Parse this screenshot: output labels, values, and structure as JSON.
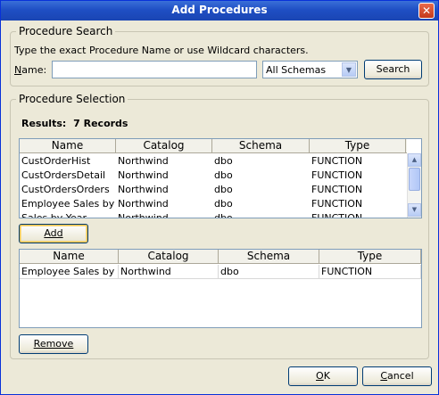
{
  "window": {
    "title": "Add Procedures",
    "close_glyph": "✕"
  },
  "search": {
    "legend": "Procedure Search",
    "instruction": "Type the exact Procedure Name or use Wildcard characters.",
    "name_label_ul": "N",
    "name_label_rest": "ame:",
    "name_value": "",
    "schema_selected": "All Schemas",
    "search_label": "Search"
  },
  "selection": {
    "legend": "Procedure Selection",
    "results_label": "Results:",
    "results_count": "7 Records",
    "columns": [
      "Name",
      "Catalog",
      "Schema",
      "Type"
    ],
    "results_rows": [
      [
        "CustOrderHist",
        "Northwind",
        "dbo",
        "FUNCTION"
      ],
      [
        "CustOrdersDetail",
        "Northwind",
        "dbo",
        "FUNCTION"
      ],
      [
        "CustOrdersOrders",
        "Northwind",
        "dbo",
        "FUNCTION"
      ],
      [
        "Employee Sales by ...",
        "Northwind",
        "dbo",
        "FUNCTION"
      ],
      [
        "Sales by Year",
        "Northwind",
        "dbo",
        "FUNCTION"
      ]
    ],
    "add_label": "Add",
    "selected_rows": [
      [
        "Employee Sales by ...",
        "Northwind",
        "dbo",
        "FUNCTION"
      ]
    ],
    "remove_label": "Remove"
  },
  "footer": {
    "ok_ul": "O",
    "ok_rest": "K",
    "cancel_ul": "C",
    "cancel_rest": "ancel"
  },
  "colors": {
    "title_bar": "#1f4fc4",
    "dialog_bg": "#ece9d8",
    "focus_ring": "#f4c44a"
  },
  "icons": {
    "combo_arrow": "chevron-down-icon",
    "scroll_up": "arrow-up-icon",
    "scroll_down": "arrow-down-icon"
  }
}
